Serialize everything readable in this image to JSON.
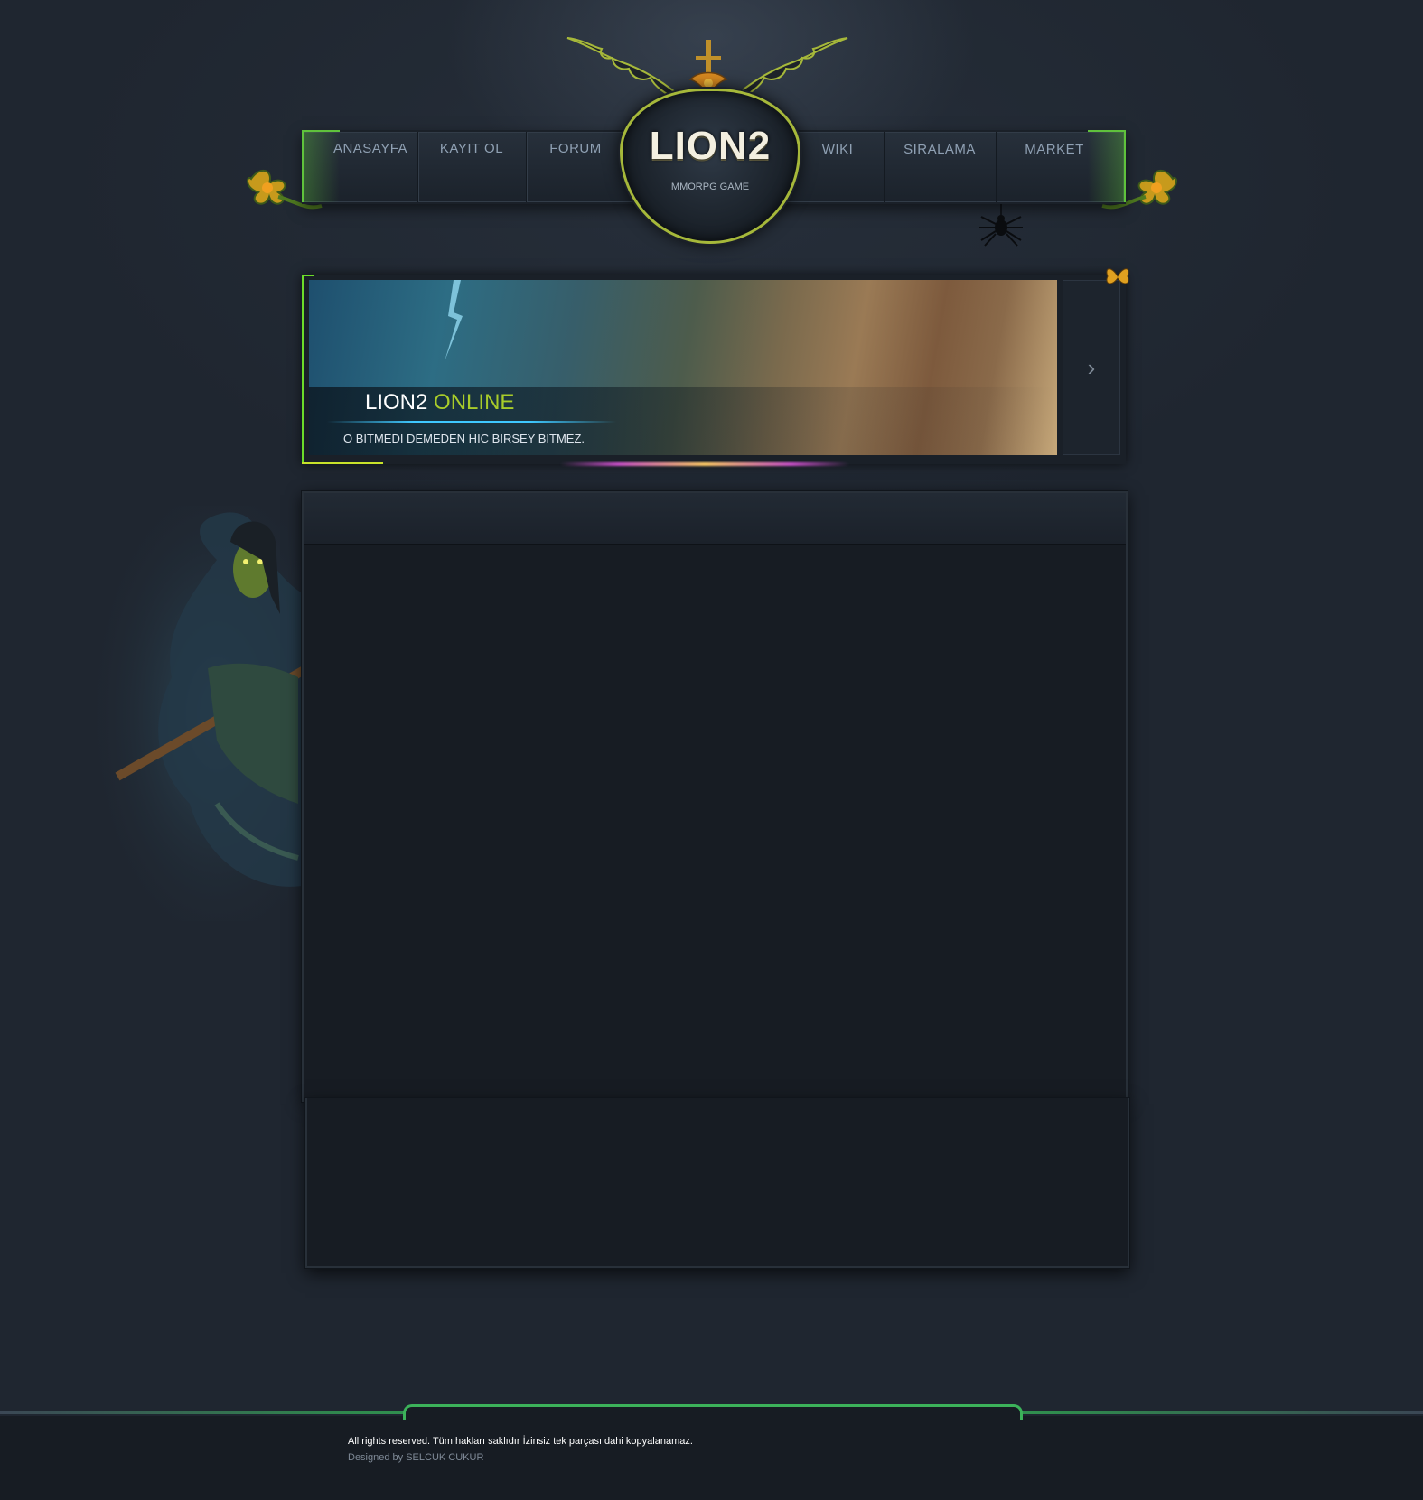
{
  "nav": {
    "items": [
      {
        "label": "ANASAYFA"
      },
      {
        "label": "KAYIT OL"
      },
      {
        "label": "FORUM"
      },
      {
        "label": "WIKI"
      },
      {
        "label": "SIRALAMA"
      },
      {
        "label": "MARKET"
      }
    ]
  },
  "logo": {
    "title": "LION2",
    "subtitle": "MMORPG GAME"
  },
  "slider": {
    "title_main": "LION2",
    "title_accent": "ONLINE",
    "description": "O BITMEDI DEMEDEN HIC BIRSEY BITMEZ.",
    "next_label": "›"
  },
  "footer": {
    "rights": "All rights reserved. Tüm hakları saklıdır İzinsiz tek parçası dahi kopyalanamaz.",
    "designed_by": "Designed by SELCUK CUKUR"
  },
  "colors": {
    "accent_green": "#a8cc2a",
    "frame_green": "#5fc23c",
    "background": "#1f2630",
    "panel": "#171c23"
  }
}
